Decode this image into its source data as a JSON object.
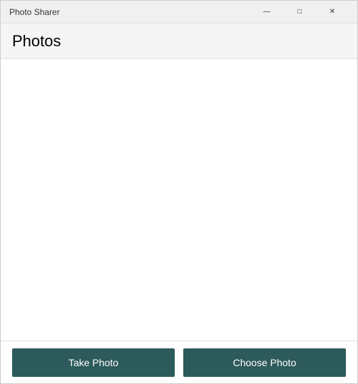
{
  "window": {
    "title": "Photo Sharer"
  },
  "titlebar": {
    "minimize_label": "—",
    "maximize_label": "□",
    "close_label": "✕"
  },
  "header": {
    "title": "Photos"
  },
  "buttons": {
    "take_photo": "Take Photo",
    "choose_photo": "Choose Photo"
  }
}
